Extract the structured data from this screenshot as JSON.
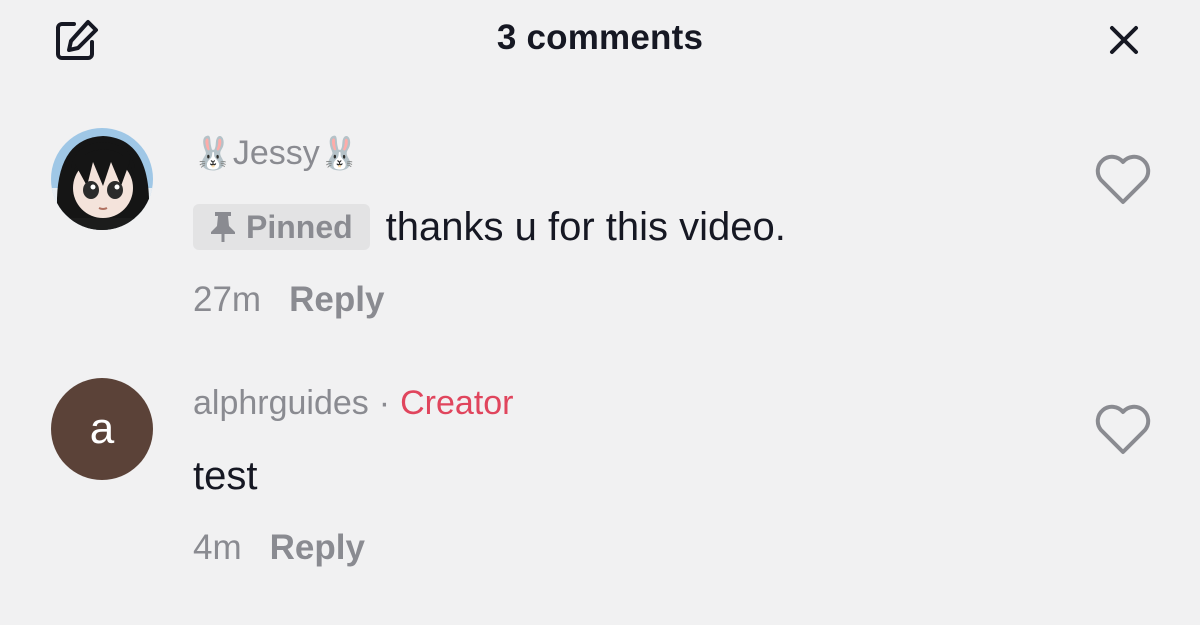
{
  "header": {
    "title": "3 comments",
    "edit_icon": "edit-icon",
    "close_icon": "close-icon"
  },
  "comments": [
    {
      "username_prefix_emoji": "🐰",
      "username": "Jessy",
      "username_suffix_emoji": "🐰",
      "pinned_label": "Pinned",
      "text": "thanks u for this video.",
      "time": "27m",
      "reply_label": "Reply",
      "avatar_icon": "anime-avatar"
    },
    {
      "avatar_letter": "a",
      "username": "alphrguides",
      "separator": "·",
      "badge": "Creator",
      "text": "test",
      "time": "4m",
      "reply_label": "Reply"
    }
  ],
  "colors": {
    "background": "#f1f1f2",
    "creator_badge": "#e0455d",
    "secondary_text": "#8a8b91",
    "avatar_letter_bg": "#5b4238"
  }
}
